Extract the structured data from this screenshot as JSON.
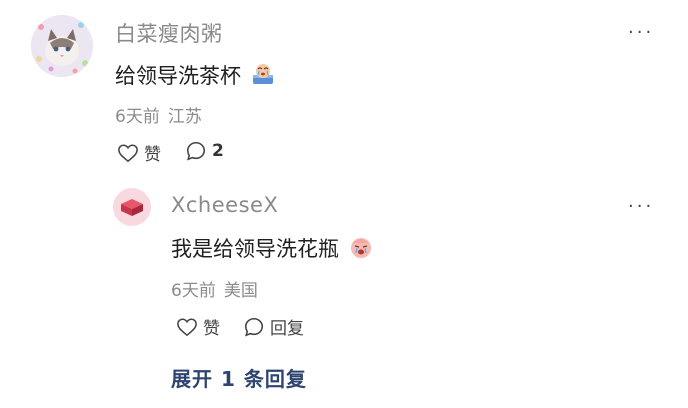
{
  "comment": {
    "username": "白菜瘦肉粥",
    "text": "给领导洗茶杯",
    "emoji_icon": "crying-cup-emoji-icon",
    "time": "6天前",
    "location": "江苏",
    "like_label": "赞",
    "reply_count": "2",
    "more": "···"
  },
  "reply": {
    "username": "XcheeseX",
    "text": "我是给领导洗花瓶",
    "emoji_icon": "crying-face-emoji-icon",
    "time": "6天前",
    "location": "美国",
    "like_label": "赞",
    "reply_label": "回复",
    "more": "···"
  },
  "expand_label": "展开 1 条回复",
  "colors": {
    "username": "#8a8a8a",
    "meta": "#8c8c8c",
    "expand_link": "#2e4470",
    "avatar2_bg": "#f7d9df",
    "avatar2_fg": "#c8354a"
  }
}
